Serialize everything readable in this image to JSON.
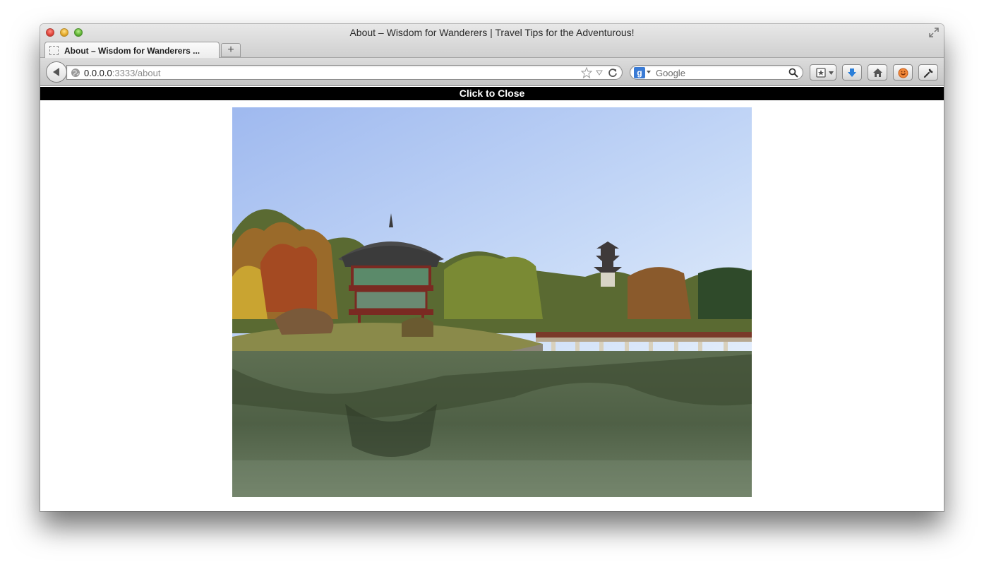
{
  "window": {
    "title": "About – Wisdom for Wanderers | Travel Tips for the Adventurous!"
  },
  "tab": {
    "label": "About – Wisdom for Wanderers ..."
  },
  "newtab": {
    "label": "+"
  },
  "urlbar": {
    "host": "0.0.0.0",
    "rest": ":3333/about"
  },
  "searchbar": {
    "engine_letter": "g",
    "placeholder": "Google"
  },
  "closebar": {
    "label": "Click to Close"
  },
  "icons": {
    "back": "back-arrow-icon",
    "bookmark": "star-icon",
    "reload": "reload-icon",
    "search": "magnifier-icon",
    "bookmarks_menu": "bookmarks-menu-icon",
    "downloads": "download-arrow-icon",
    "home": "home-icon",
    "addon": "addon-icon",
    "tools": "wrench-icon"
  },
  "colors": {
    "closebar_bg": "#000000",
    "download_blue": "#2b7fd9",
    "sky": "#b6cef5",
    "water": "#55684a"
  }
}
